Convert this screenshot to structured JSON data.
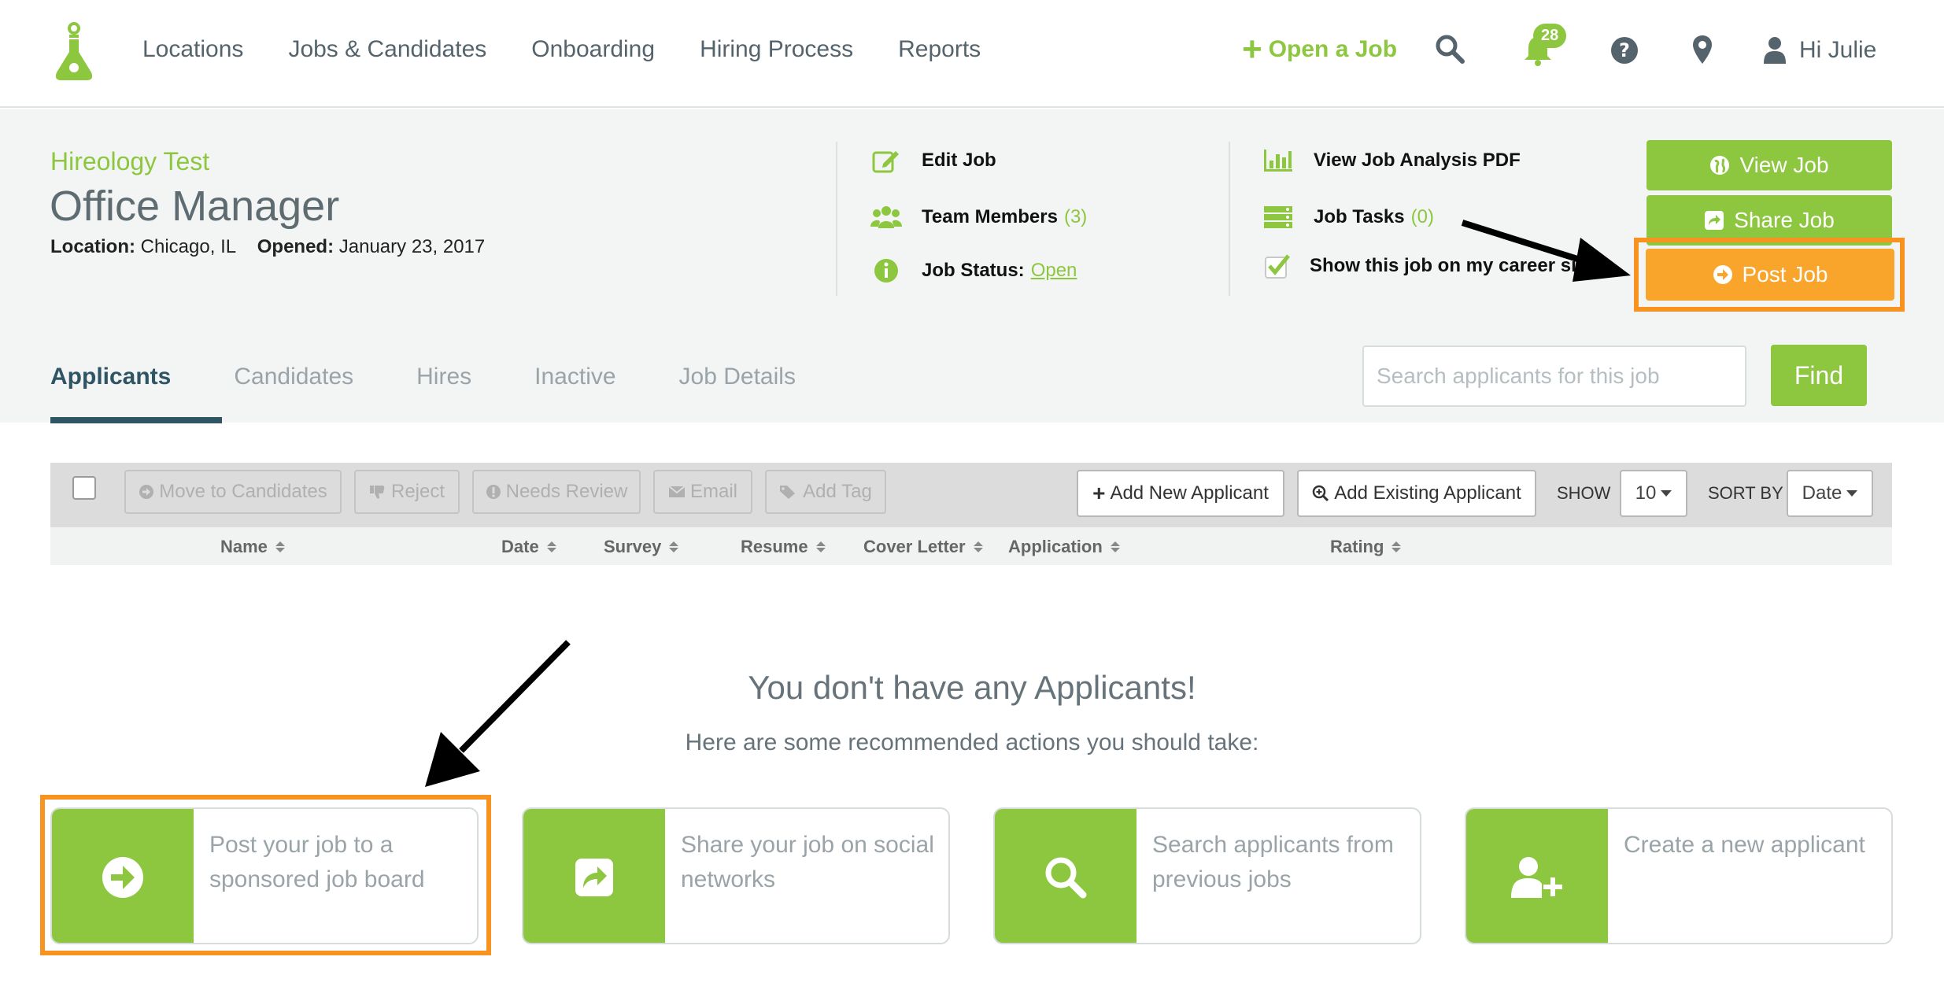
{
  "nav": {
    "links": [
      "Locations",
      "Jobs & Candidates",
      "Onboarding",
      "Hiring Process",
      "Reports"
    ],
    "open_job": "Open a Job",
    "notification_count": "28",
    "greeting": "Hi Julie",
    "accent_color": "#8dc63f"
  },
  "job": {
    "company": "Hireology Test",
    "title": "Office Manager",
    "location_label": "Location:",
    "location": "Chicago, IL",
    "opened_label": "Opened:",
    "opened": "January 23, 2017"
  },
  "actions": {
    "edit_job": "Edit Job",
    "team_members": "Team Members",
    "team_members_count": "(3)",
    "job_status": "Job Status:",
    "job_status_value": "Open",
    "view_pdf": "View Job Analysis PDF",
    "job_tasks": "Job Tasks",
    "job_tasks_count": "(0)",
    "career_site": "Show this job on my career site"
  },
  "buttons": {
    "view_job": "View Job",
    "share_job": "Share Job",
    "post_job": "Post Job"
  },
  "tabs": [
    "Applicants",
    "Candidates",
    "Hires",
    "Inactive",
    "Job Details"
  ],
  "search": {
    "placeholder": "Search applicants for this job",
    "find": "Find"
  },
  "toolbar": {
    "move": "Move to Candidates",
    "reject": "Reject",
    "needs_review": "Needs Review",
    "email": "Email",
    "add_tag": "Add Tag",
    "add_new": "Add New Applicant",
    "add_existing": "Add Existing Applicant",
    "show_label": "SHOW",
    "show_value": "10",
    "sort_label": "SORT BY",
    "sort_value": "Date"
  },
  "columns": [
    "Name",
    "Date",
    "Survey",
    "Resume",
    "Cover Letter",
    "Application",
    "Rating"
  ],
  "empty": {
    "title": "You don't have any Applicants!",
    "subtitle": "Here are some recommended actions you should take:",
    "cards": [
      "Post your job to a sponsored job board",
      "Share your job on social networks",
      "Search applicants from previous jobs",
      "Create a new applicant"
    ]
  }
}
